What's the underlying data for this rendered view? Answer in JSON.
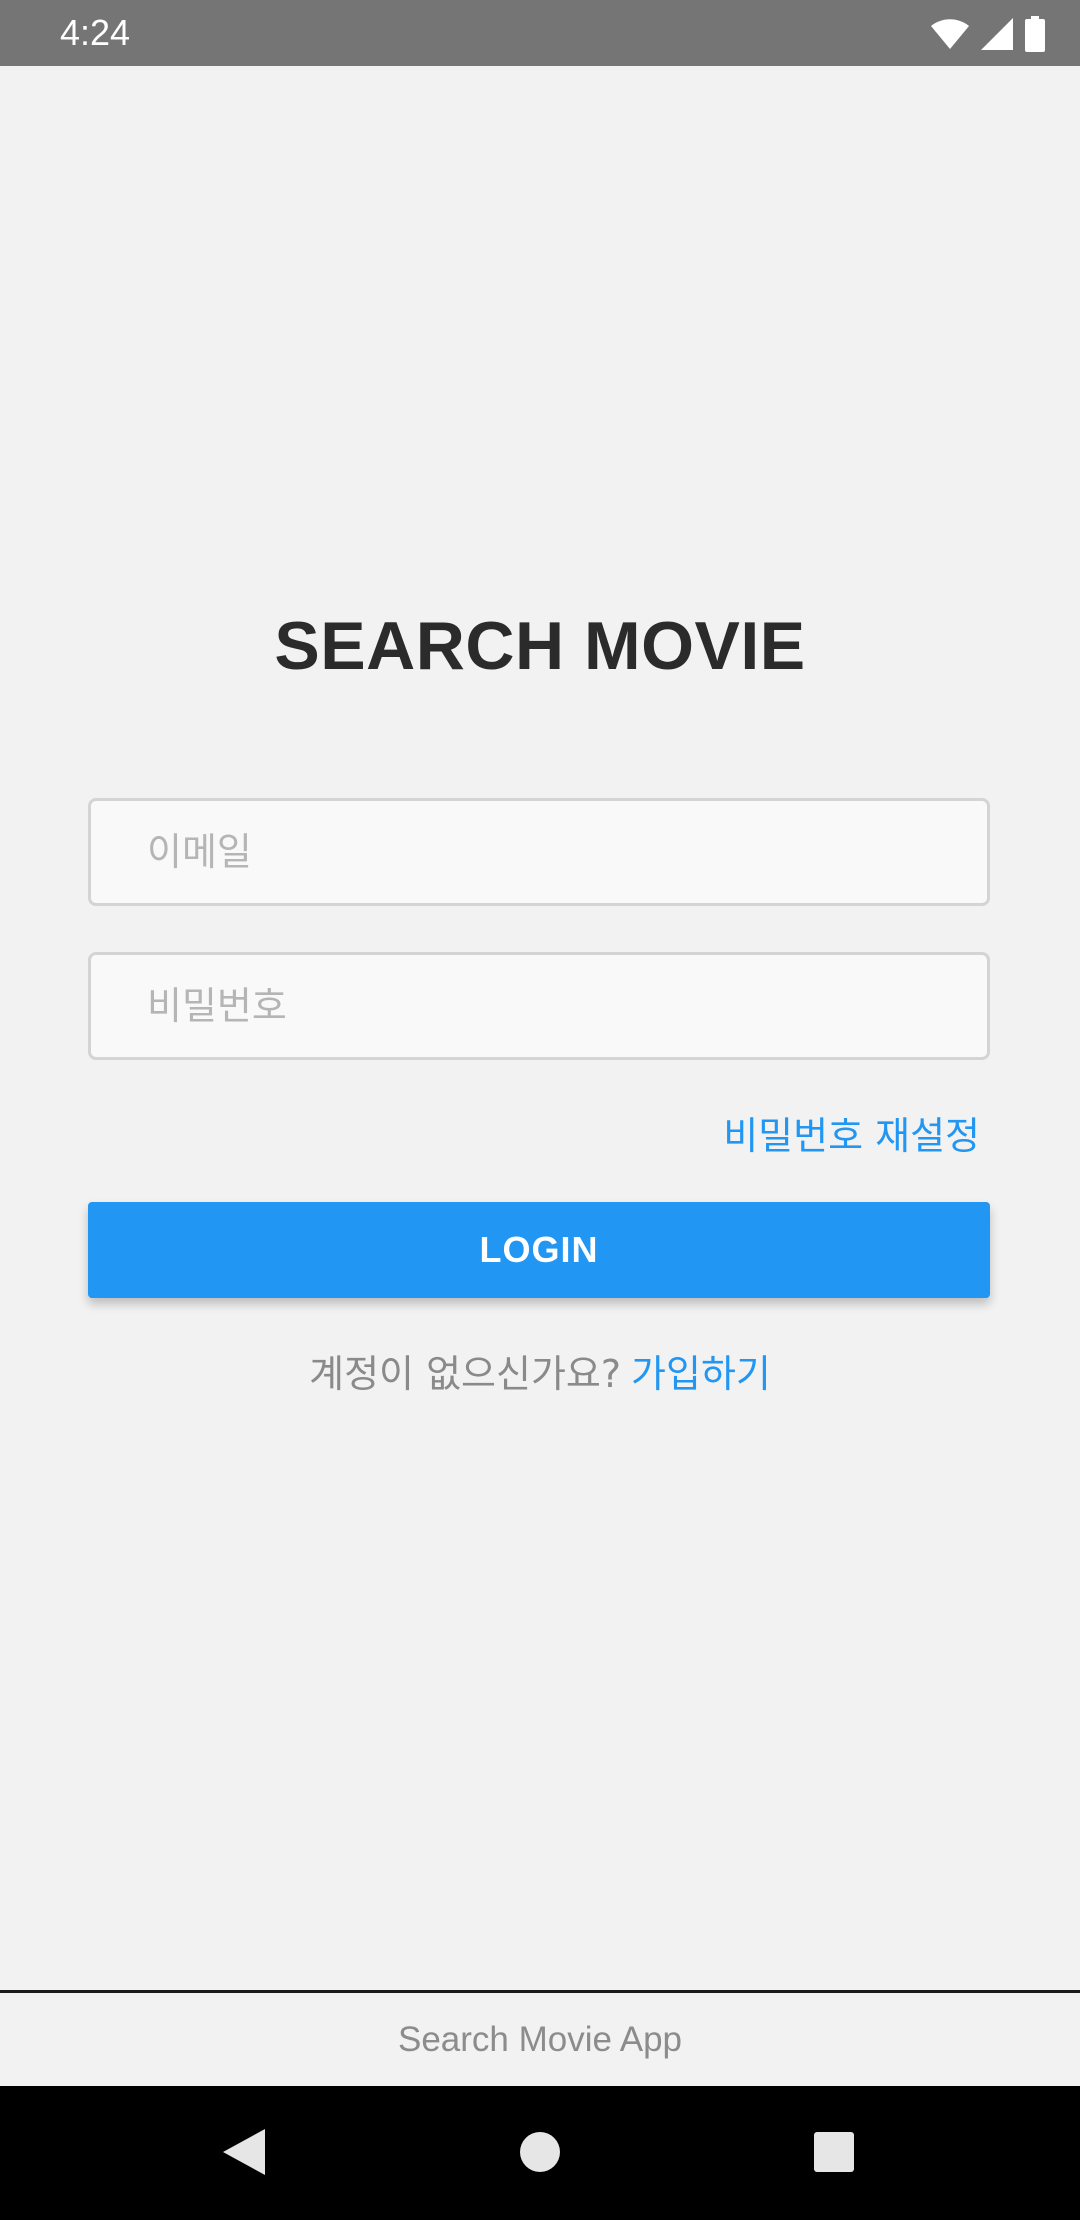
{
  "status_bar": {
    "time": "4:24",
    "icons": [
      "wifi-icon",
      "cellular-signal-icon",
      "battery-icon"
    ]
  },
  "app": {
    "title": "SEARCH MOVIE"
  },
  "form": {
    "email_placeholder": "이메일",
    "email_value": "",
    "password_placeholder": "비밀번호",
    "password_value": "",
    "reset_password_label": "비밀번호 재설정",
    "login_label": "LOGIN",
    "signup_prompt": "계정이 없으신가요?",
    "signup_link": "가입하기"
  },
  "footer": {
    "text": "Search Movie App"
  },
  "nav_bar": {
    "icons": [
      "back-icon",
      "home-icon",
      "recents-icon"
    ]
  },
  "colors": {
    "accent": "#2196f3",
    "status_bar": "#757575",
    "background": "#f2f2f2",
    "title": "#2b2b2b"
  }
}
